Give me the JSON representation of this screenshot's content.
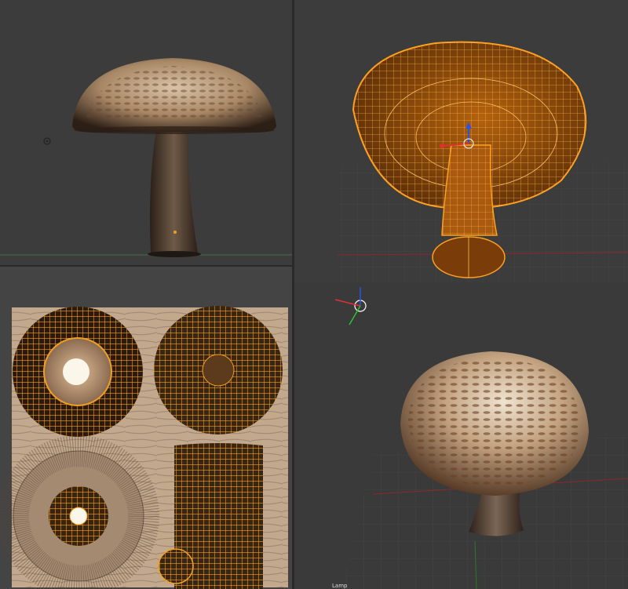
{
  "viewports": {
    "front": {
      "name": "front-view"
    },
    "wireframe": {
      "name": "edit-mode-wireframe-view"
    },
    "uv": {
      "name": "uv-texture-editor"
    },
    "perspective": {
      "name": "perspective-render-view",
      "object_label": "Lamp"
    }
  },
  "colors": {
    "background": "#3c3c3c",
    "selection": "#f0a020",
    "wire": "#e8901a",
    "grid_red": "#8a2a2a",
    "axis_x": "#e03030",
    "axis_y": "#30c030",
    "axis_z": "#3050e0"
  },
  "icons": [
    "lamp-icon",
    "3d-cursor-icon",
    "transform-gizmo-icon",
    "object-origin-icon"
  ]
}
